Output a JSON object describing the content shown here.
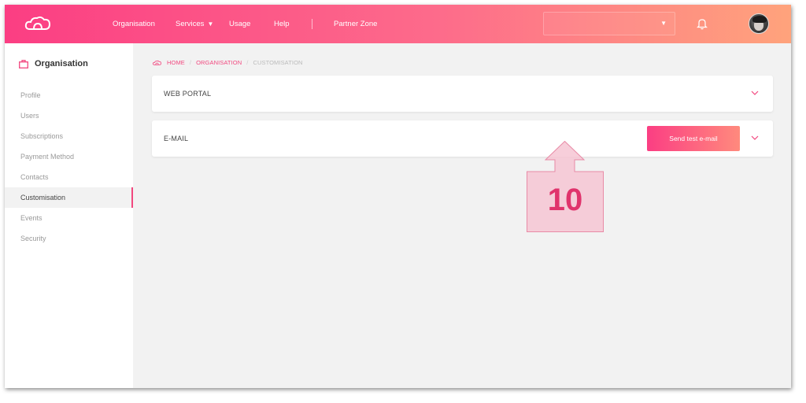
{
  "topbar": {
    "nav": {
      "organisation": "Organisation",
      "services": "Services",
      "services_caret": "▼",
      "usage": "Usage",
      "help": "Help",
      "partner_zone": "Partner Zone"
    },
    "search_caret": "▼",
    "icons": {
      "logo": "cloud-logo-icon",
      "bell": "bell-icon",
      "avatar": "user-avatar"
    }
  },
  "sidebar": {
    "title": "Organisation",
    "title_icon": "briefcase-icon",
    "items": [
      {
        "label": "Profile",
        "active": false
      },
      {
        "label": "Users",
        "active": false
      },
      {
        "label": "Subscriptions",
        "active": false
      },
      {
        "label": "Payment Method",
        "active": false
      },
      {
        "label": "Contacts",
        "active": false
      },
      {
        "label": "Customisation",
        "active": true
      },
      {
        "label": "Events",
        "active": false
      },
      {
        "label": "Security",
        "active": false
      }
    ]
  },
  "breadcrumb": {
    "home": "HOME",
    "organisation": "ORGANISATION",
    "current": "CUSTOMISATION",
    "separator": "/"
  },
  "sections": {
    "web_portal": {
      "title": "WEB PORTAL"
    },
    "email": {
      "title": "E-MAIL",
      "button_label": "Send test e-mail"
    }
  },
  "annotation": {
    "number": "10"
  },
  "colors": {
    "accent": "#f2487f",
    "gradient_start": "#fb3e83",
    "gradient_end": "#ffa37c",
    "annotation_fill": "#f6c6d3",
    "annotation_text": "#e0336c"
  }
}
